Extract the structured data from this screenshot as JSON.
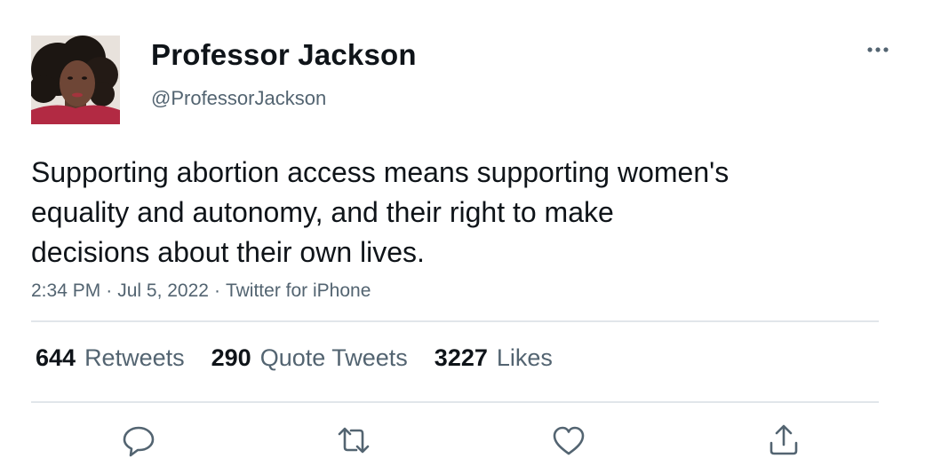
{
  "author": {
    "display_name": "Professor Jackson",
    "handle": "@ProfessorJackson"
  },
  "tweet": {
    "text": "Supporting abortion access means supporting women's\nequality and autonomy, and their right to make\ndecisions about their own lives.",
    "time": "2:34 PM",
    "date": "Jul 5, 2022",
    "source": "Twitter for iPhone",
    "separator": "·"
  },
  "stats": {
    "retweets": {
      "count": "644",
      "label": "Retweets"
    },
    "quote_tweets": {
      "count": "290",
      "label": "Quote Tweets"
    },
    "likes": {
      "count": "3227",
      "label": "Likes"
    }
  },
  "icons": {
    "more": "more-horizontal-icon",
    "reply": "reply-icon",
    "retweet": "retweet-icon",
    "like": "heart-icon",
    "share": "share-icon"
  },
  "colors": {
    "text_primary": "#0f1419",
    "text_secondary": "#536471",
    "divider": "#e1e6ea",
    "icon": "#536471"
  }
}
